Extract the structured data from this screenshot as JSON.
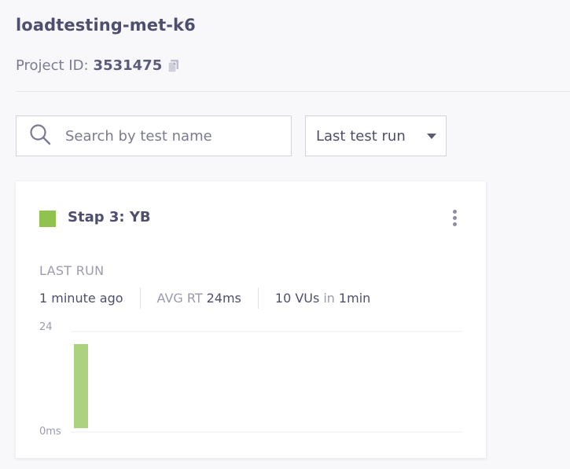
{
  "project": {
    "title": "loadtesting-met-k6",
    "id_label": "Project ID:",
    "id_value": "3531475"
  },
  "icons": {
    "copy": "copy-icon",
    "search": "search-icon",
    "caret": "chevron-down-icon",
    "menu": "kebab-menu-icon"
  },
  "search": {
    "placeholder": "Search by test name",
    "value": ""
  },
  "sort_select": {
    "selected": "Last test run"
  },
  "test_card": {
    "name": "Stap 3: YB",
    "status_color": "#8fc24e",
    "last_run_label": "LAST RUN",
    "time_ago": "1 minute ago",
    "avg_rt_label": "AVG RT",
    "avg_rt_value": "24ms",
    "vus_value": "10 VUs",
    "vus_in": "in",
    "duration": "1min"
  },
  "chart_data": {
    "type": "bar",
    "y_tick_labels": [
      "24",
      "0ms"
    ],
    "ylim": [
      0,
      24
    ],
    "values": [
      24
    ],
    "bar_color": "#acd27f"
  }
}
